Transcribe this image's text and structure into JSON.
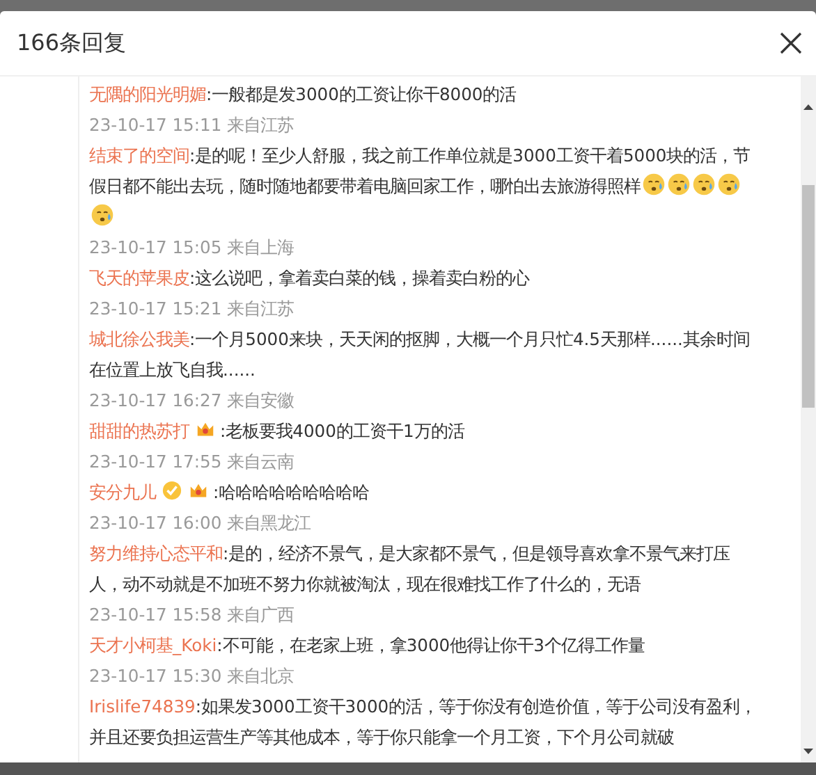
{
  "dialog": {
    "title": "166条回复"
  },
  "replies": [
    {
      "author": "无隅的阳光明媚",
      "text": ":一般都是发3000的工资让你干8000的活",
      "meta": "23-10-17 15:11 来自江苏"
    },
    {
      "author": "结束了的空间",
      "text": ":是的呢！至少人舒服，我之前工作单位就是3000工资干着5000块的活，节假日都不能出去玩，随时随地都要带着电脑回家工作，哪怕出去旅游得照样",
      "emojis": [
        {
          "kind": "sweat"
        },
        {
          "kind": "sweat"
        },
        {
          "kind": "sweat"
        },
        {
          "kind": "sweat"
        },
        {
          "kind": "sweat"
        }
      ],
      "meta": "23-10-17 15:05 来自上海"
    },
    {
      "author": "飞天的苹果皮",
      "text": ":这么说吧，拿着卖白菜的钱，操着卖白粉的心",
      "meta": "23-10-17 15:21 来自江苏"
    },
    {
      "author": "城北徐公我美",
      "text": ":一个月5000来块，天天闲的抠脚，大概一个月只忙4.5天那样......其余时间在位置上放飞自我......",
      "meta": "23-10-17 16:27 来自安徽"
    },
    {
      "author": "甜甜的热苏打",
      "badges": [
        {
          "kind": "crown"
        }
      ],
      "text": ":老板要我4000的工资干1万的活",
      "meta": "23-10-17 17:55 来自云南"
    },
    {
      "author": "安分九儿",
      "badges": [
        {
          "kind": "verified"
        },
        {
          "kind": "crown"
        }
      ],
      "text": ":哈哈哈哈哈哈哈哈哈",
      "meta": "23-10-17 16:00 来自黑龙江"
    },
    {
      "author": "努力维持心态平和",
      "text": ":是的，经济不景气，是大家都不景气，但是领导喜欢拿不景气来打压人，动不动就是不加班不努力你就被淘汰，现在很难找工作了什么的，无语",
      "meta": "23-10-17 15:58 来自广西"
    },
    {
      "author": "天才小柯基_Koki",
      "text": ":不可能，在老家上班，拿3000他得让你干3个亿得工作量",
      "meta": "23-10-17 15:30 来自北京"
    },
    {
      "author": "Irislife74839",
      "text": ":如果发3000工资干3000的活，等于你没有创造价值，等于公司没有盈利，并且还要负担运营生产等其他成本，等于你只能拿一个月工资，下个月公司就破"
    }
  ]
}
